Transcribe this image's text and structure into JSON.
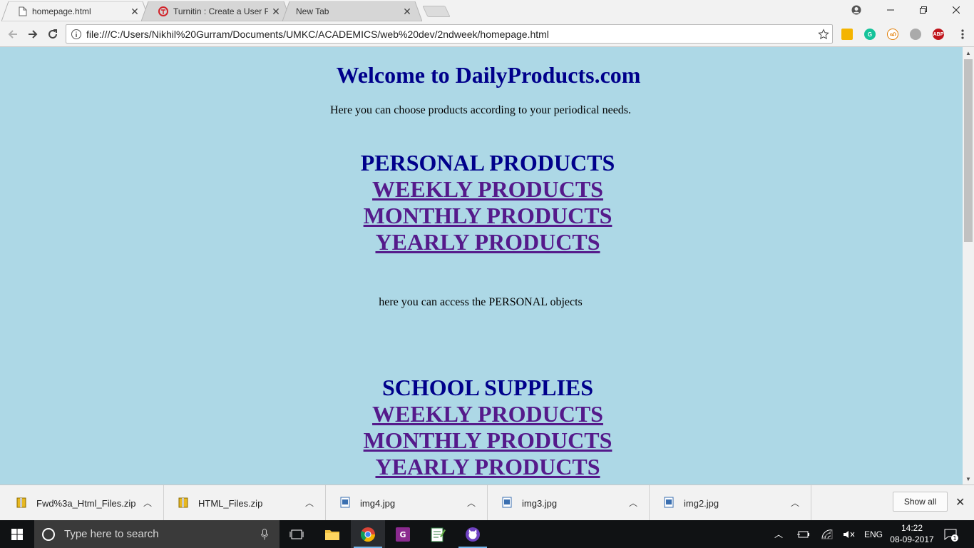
{
  "tabs": [
    {
      "title": "homepage.html",
      "active": true
    },
    {
      "title": "Turnitin : Create a User P",
      "active": false
    },
    {
      "title": "New Tab",
      "active": false
    }
  ],
  "omnibox": {
    "url": "file:///C:/Users/Nikhil%20Gurram/Documents/UMKC/ACADEMICS/web%20dev/2ndweek/homepage.html"
  },
  "extensions": {
    "abp_label": "ABP"
  },
  "page": {
    "title": "Welcome to DailyProducts.com",
    "intro": "Here you can choose products according to your periodical needs.",
    "sections": [
      {
        "heading": "PERSONAL PRODUCTS",
        "links": [
          "WEEKLY PRODUCTS",
          "MONTHLY PRODUCTS",
          "YEARLY PRODUCTS"
        ],
        "text": "here you can access the PERSONAL objects"
      },
      {
        "heading": "SCHOOL SUPPLIES",
        "links": [
          "WEEKLY PRODUCTS",
          "MONTHLY PRODUCTS",
          "YEARLY PRODUCTS"
        ]
      }
    ]
  },
  "downloads": {
    "items": [
      "Fwd%3a_Html_Files.zip",
      "HTML_Files.zip",
      "img4.jpg",
      "img3.jpg",
      "img2.jpg"
    ],
    "show_all": "Show all"
  },
  "taskbar": {
    "search_placeholder": "Type here to search",
    "language": "ENG",
    "time": "14:22",
    "date": "08-09-2017",
    "notification_count": "1"
  },
  "colors": {
    "page_background": "#add8e6",
    "heading": "#00008b",
    "link": "#551a8b"
  }
}
